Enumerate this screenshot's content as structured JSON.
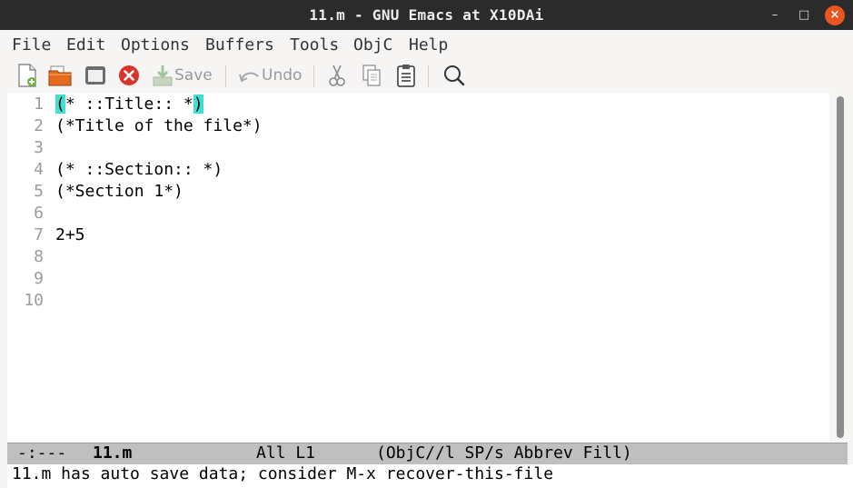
{
  "window": {
    "title": "11.m - GNU Emacs at X10DAi"
  },
  "window_controls": {
    "minimize": "–",
    "maximize": "□",
    "close": "×"
  },
  "menu": [
    "File",
    "Edit",
    "Options",
    "Buffers",
    "Tools",
    "ObjC",
    "Help"
  ],
  "toolbar": {
    "items": [
      {
        "name": "new-file-icon"
      },
      {
        "name": "open-folder-icon"
      },
      {
        "name": "dired-icon"
      },
      {
        "name": "kill-buffer-icon"
      },
      {
        "name": "save-icon",
        "label": "Save"
      },
      {
        "name": "undo-icon",
        "label": "Undo"
      },
      {
        "name": "cut-icon"
      },
      {
        "name": "copy-icon"
      },
      {
        "name": "paste-icon"
      },
      {
        "name": "search-icon"
      }
    ]
  },
  "editor": {
    "line_numbers": [
      "1",
      "2",
      "3",
      "4",
      "5",
      "6",
      "7",
      "8",
      "9",
      "10"
    ],
    "lines": [
      {
        "pre": "(",
        "mid": "* ::Title:: *",
        "post": ")"
      },
      {
        "text": "(*Title of the file*)"
      },
      {
        "text": ""
      },
      {
        "text": "(* ::Section:: *)"
      },
      {
        "text": "(*Section 1*)"
      },
      {
        "text": ""
      },
      {
        "text": "2+5"
      },
      {
        "text": ""
      },
      {
        "text": ""
      },
      {
        "text": ""
      }
    ]
  },
  "modeline": {
    "status": "-:---",
    "buffer": "11.m",
    "position": "All L1",
    "modes": "(ObjC//l SP/s Abbrev Fill)"
  },
  "echo_area": "11.m has auto save data; consider M-x recover-this-file",
  "colors": {
    "paren_match": "#40e0d0",
    "close_button": "#e95420",
    "titlebar": "#2b2b2b"
  }
}
